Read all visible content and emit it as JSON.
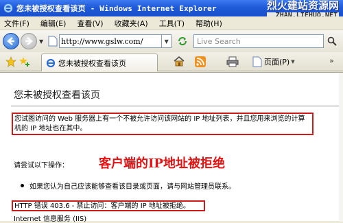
{
  "window": {
    "title": "您未被授权查看该页 - Windows Internet Explorer"
  },
  "watermark": {
    "site_name": "烈火建站资源网",
    "site_url": "ZHAN.LIEHUO.NET"
  },
  "menu": {
    "items": [
      "文件(F)",
      "编辑(E)",
      "查看(V)",
      "收藏夹(A)",
      "工具(T)",
      "帮助(H)"
    ]
  },
  "address": {
    "url": "http://www.gslw.com/",
    "search_placeholder": "Live Search"
  },
  "tab": {
    "label": "您未被授权查看该页"
  },
  "toolbar": {
    "page_label": "页面(P)"
  },
  "content": {
    "heading": "您未被授权查看该页",
    "description": "您试图访问的 Web 服务器上有一个不被允许访问该网站的 IP 地址列表，并且您用来浏览的计算机的 IP 地址也在其中。",
    "try_label": "请尝试以下操作：",
    "annotation": "客户端的IP地址被拒绝",
    "bullet": "如果您认为自己应该能够查看该目录或页面，请与网站管理员联系。",
    "error_line": "HTTP 错误 403.6 - 禁止访问：客户端的 IP 地址被拒绝。",
    "footer": "Internet 信息服务 (IIS)"
  },
  "colors": {
    "titlebar": "#1f5ad8",
    "highlight_red": "#cc1b1b",
    "annotation_red": "#e21212"
  }
}
